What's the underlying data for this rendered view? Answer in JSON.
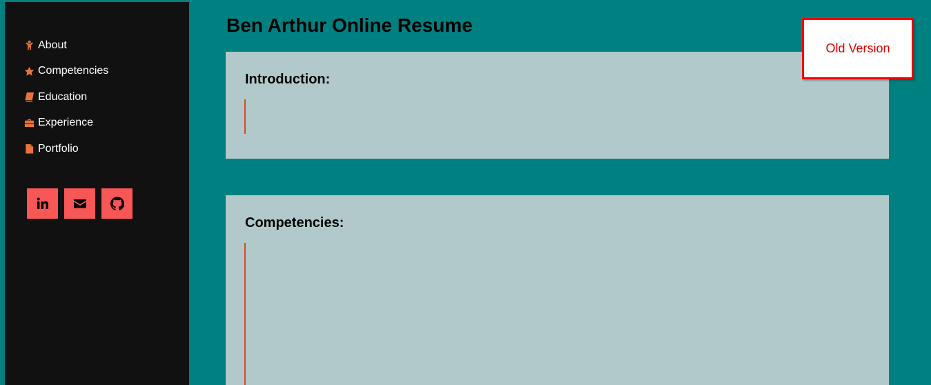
{
  "sidebar": {
    "items": [
      {
        "label": "About",
        "icon": "child-icon"
      },
      {
        "label": "Competencies",
        "icon": "star-icon"
      },
      {
        "label": "Education",
        "icon": "book-icon"
      },
      {
        "label": "Experience",
        "icon": "briefcase-icon"
      },
      {
        "label": "Portfolio",
        "icon": "file-icon"
      }
    ],
    "social": [
      {
        "icon": "linkedin-icon"
      },
      {
        "icon": "envelope-icon"
      },
      {
        "icon": "github-icon"
      }
    ]
  },
  "main": {
    "title": "Ben Arthur Online Resume",
    "sections": [
      {
        "heading": "Introduction:"
      },
      {
        "heading": "Competencies:"
      }
    ]
  },
  "old_version": {
    "label": "Old Version"
  },
  "colors": {
    "background": "#008080",
    "sidebar": "#111111",
    "accent_icon": "#e8743b",
    "social_button": "#f95656",
    "card": "#b1c9ca",
    "rule": "#e0452a",
    "old_version_border": "#ee0000"
  }
}
